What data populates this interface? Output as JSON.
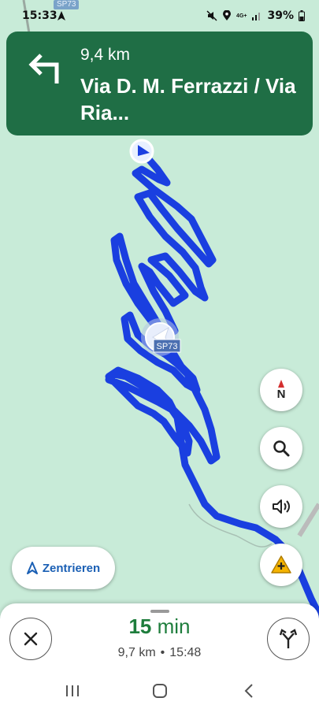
{
  "status_bar": {
    "time": "15:33",
    "road_chip": "SP73",
    "network": "4G+",
    "battery": "39%"
  },
  "navigation": {
    "distance": "9,4 km",
    "street": "Via D. M. Ferrazzi / Via Ria...",
    "turn_direction": "turn-left-icon"
  },
  "map": {
    "route_color": "#1a3fe0",
    "background_color": "#c8ebd8",
    "road_label": "SP73"
  },
  "controls": {
    "compass_letter": "N",
    "center_label": "Zentrieren"
  },
  "trip": {
    "eta_value": "15",
    "eta_unit": "min",
    "distance": "9,7 km",
    "separator": "•",
    "arrival": "15:48"
  }
}
